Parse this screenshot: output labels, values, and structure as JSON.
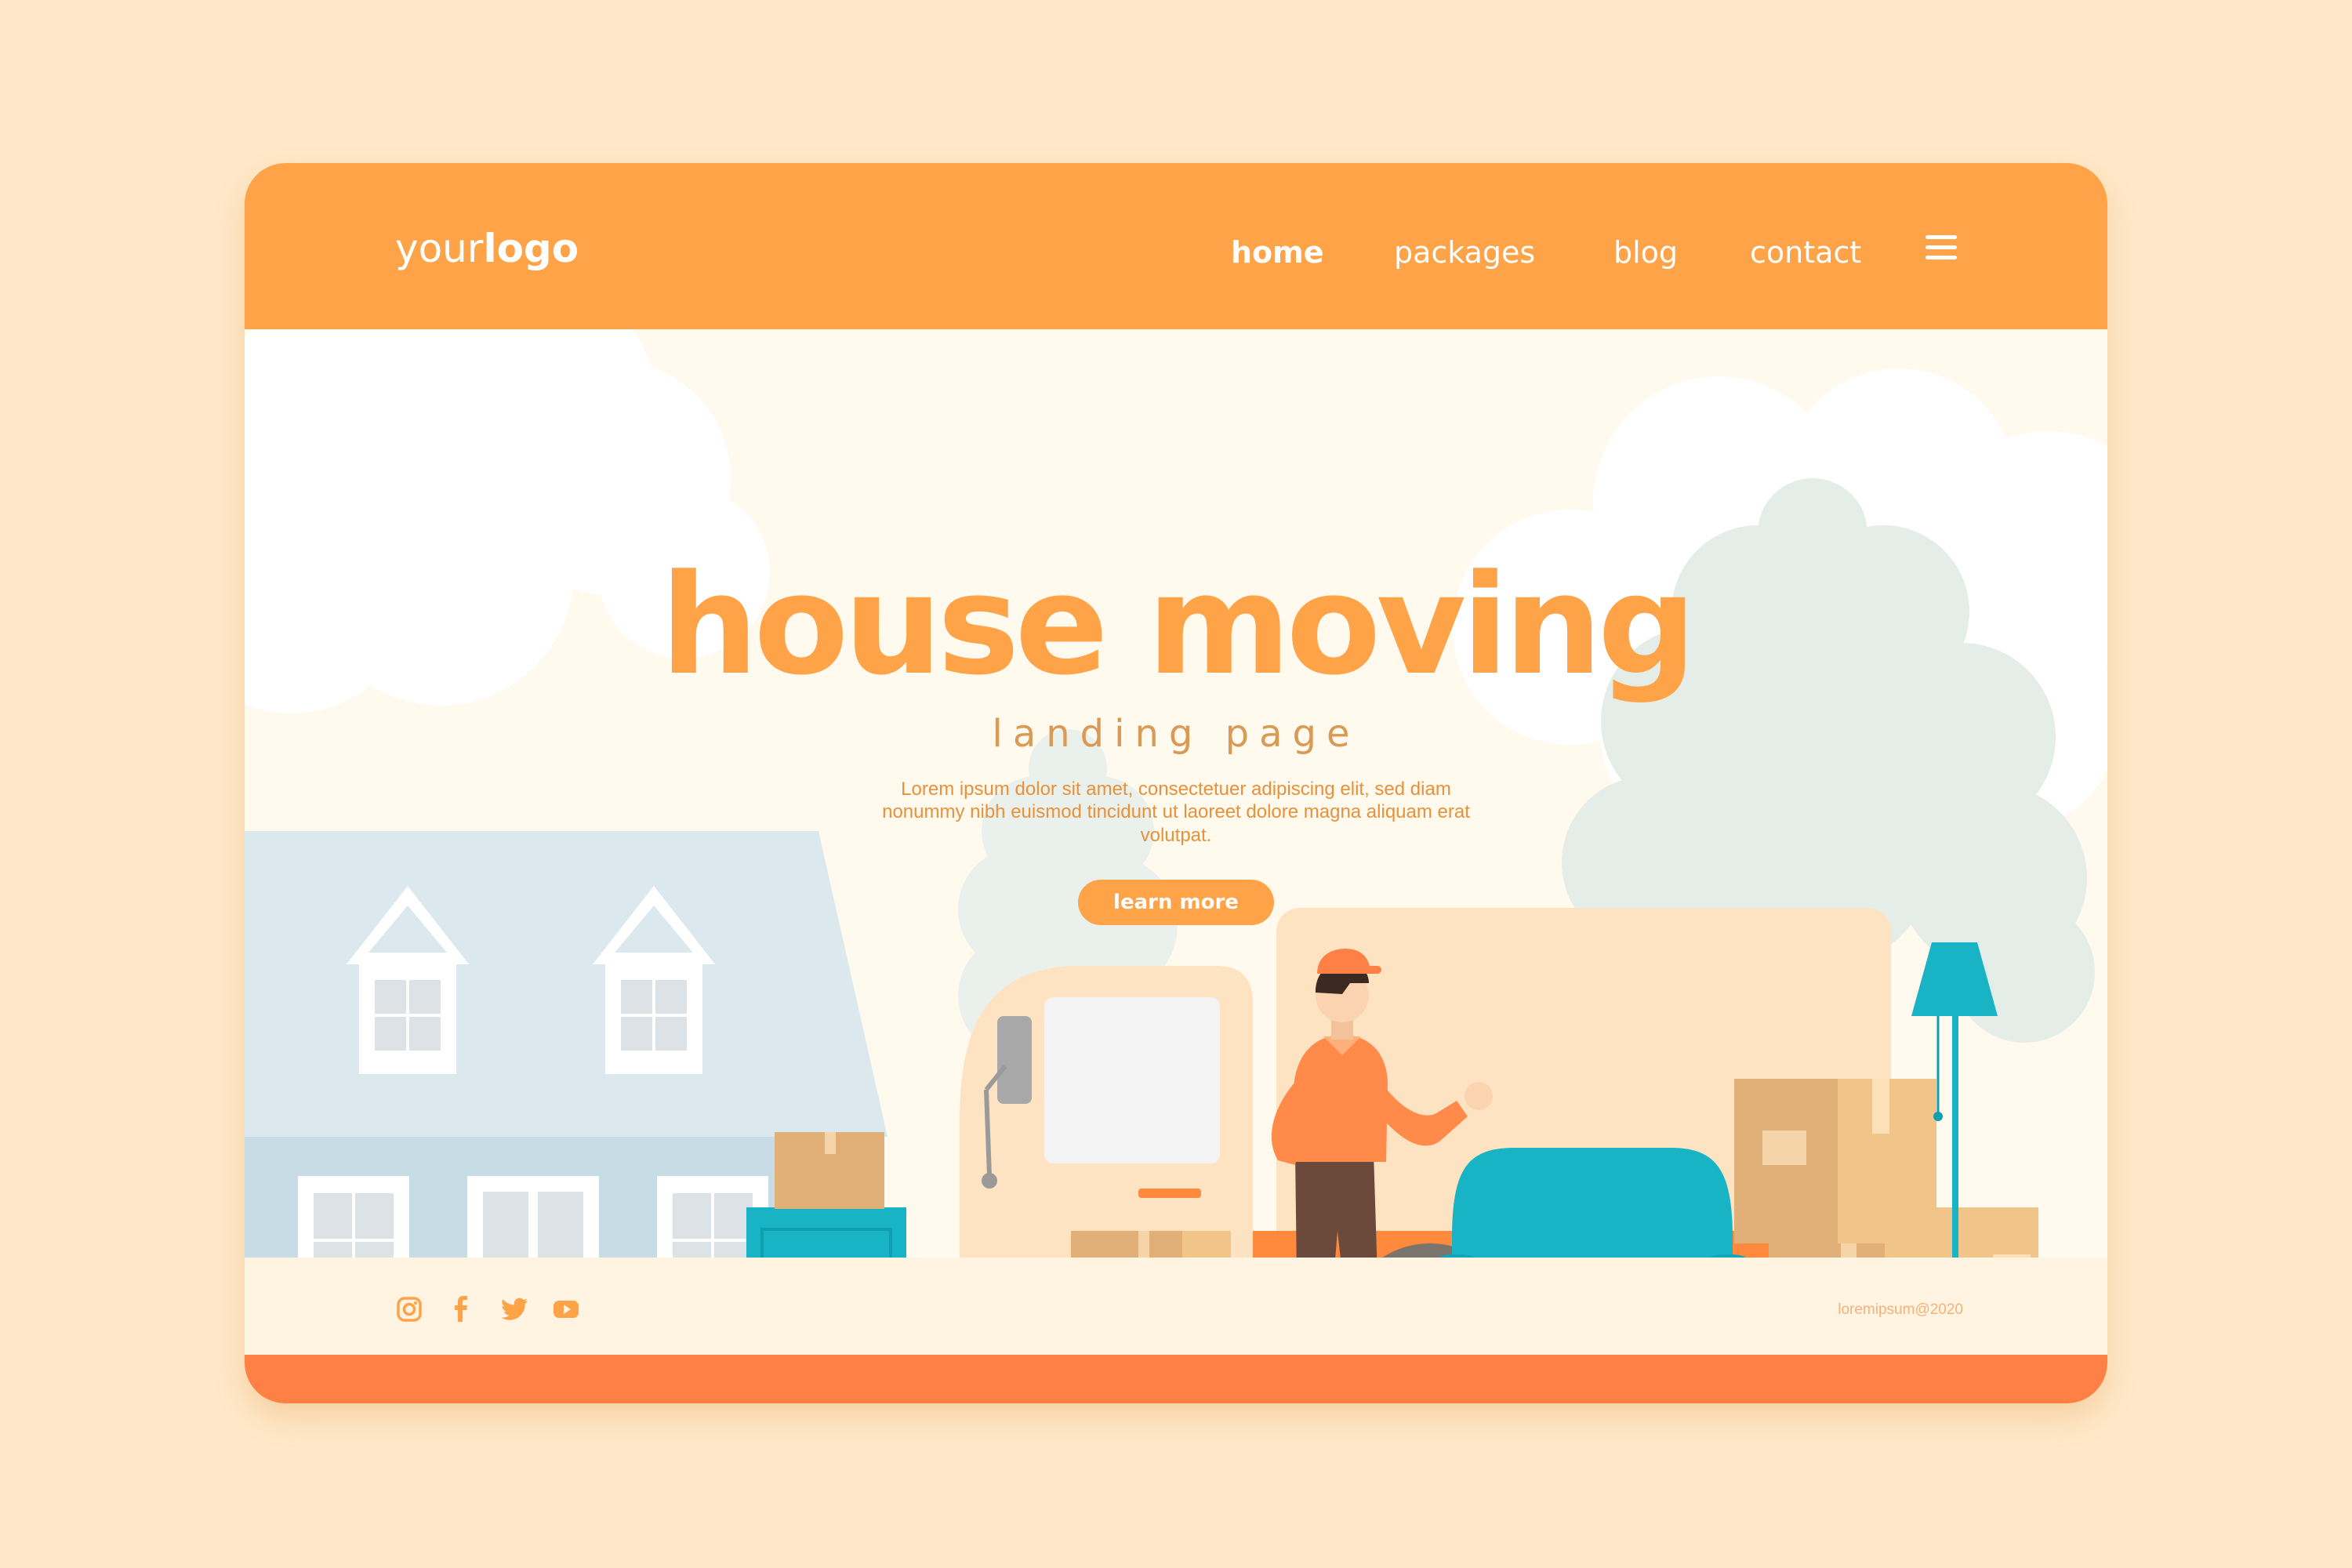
{
  "logo": {
    "light": "your",
    "bold": "logo"
  },
  "nav": {
    "items": [
      {
        "label": "home",
        "active": true
      },
      {
        "label": "packages",
        "active": false
      },
      {
        "label": "blog",
        "active": false
      },
      {
        "label": "contact",
        "active": false
      }
    ],
    "menu_icon": "hamburger-icon"
  },
  "hero": {
    "title": "house moving",
    "subtitle": "landing page",
    "text": "Lorem ipsum dolor sit amet, consectetuer adipiscing elit, sed diam nonummy nibh euismod tincidunt ut laoreet dolore magna aliquam erat volutpat.",
    "cta_label": "learn more"
  },
  "footer": {
    "social_icons": [
      "instagram-icon",
      "facebook-icon",
      "twitter-icon",
      "youtube-icon"
    ],
    "copyright": "loremipsum@2020"
  },
  "colors": {
    "background": "#fee8c8",
    "header": "#fea347",
    "accent_orange": "#ff8045",
    "teal": "#18b4c6",
    "box": "#e1b079",
    "house": "#dbe9ef"
  }
}
